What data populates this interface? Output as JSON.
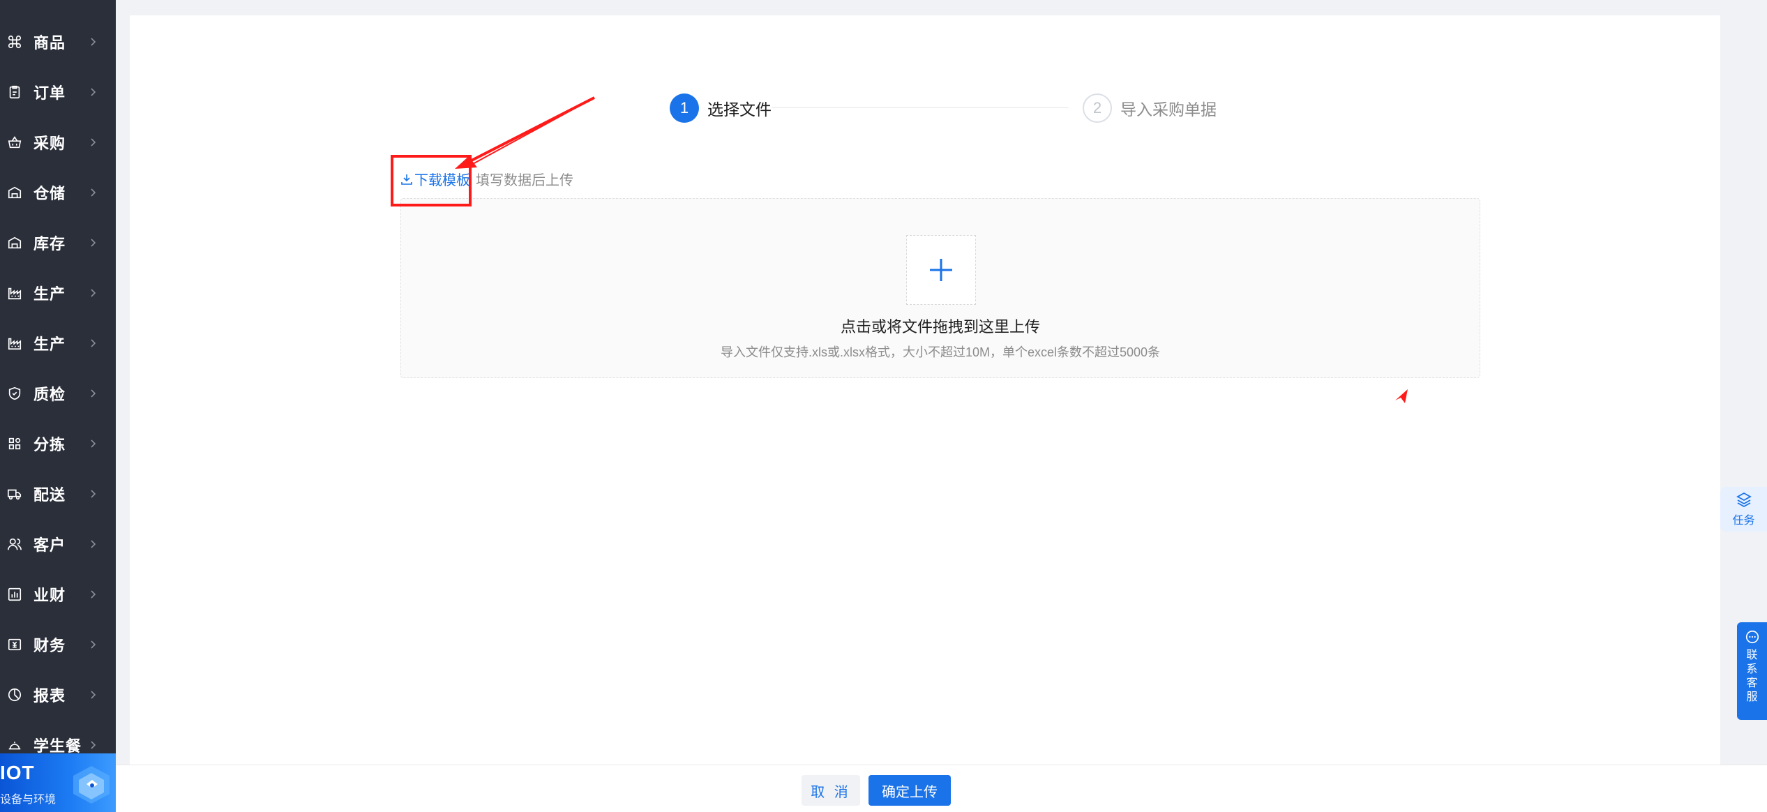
{
  "sidebar": {
    "items": [
      {
        "label": "商品",
        "icon": "command-icon"
      },
      {
        "label": "订单",
        "icon": "clipboard-icon"
      },
      {
        "label": "采购",
        "icon": "basket-icon"
      },
      {
        "label": "仓储",
        "icon": "warehouse-icon"
      },
      {
        "label": "库存",
        "icon": "warehouse-icon"
      },
      {
        "label": "生产",
        "icon": "factory-icon"
      },
      {
        "label": "生产",
        "icon": "factory-icon"
      },
      {
        "label": "质检",
        "icon": "shield-icon"
      },
      {
        "label": "分拣",
        "icon": "sort-icon"
      },
      {
        "label": "配送",
        "icon": "truck-icon"
      },
      {
        "label": "客户",
        "icon": "users-icon"
      },
      {
        "label": "业财",
        "icon": "bar-chart-icon"
      },
      {
        "label": "财务",
        "icon": "finance-icon"
      },
      {
        "label": "报表",
        "icon": "pie-chart-icon"
      },
      {
        "label": "学生餐",
        "icon": "dish-icon"
      }
    ],
    "iot_banner": {
      "title": "IOT",
      "subtitle": "设备与环境"
    }
  },
  "steps": [
    {
      "number": "1",
      "title": "选择文件",
      "state": "active"
    },
    {
      "number": "2",
      "title": "导入采购单据",
      "state": "inactive"
    }
  ],
  "download": {
    "link_label": "下载模板",
    "hint": "填写数据后上传"
  },
  "upload": {
    "title": "点击或将文件拖拽到这里上传",
    "description": "导入文件仅支持.xls或.xlsx格式，大小不超过10M，单个excel条数不超过5000条"
  },
  "floating": {
    "task_label": "任务",
    "service_label": "联系客服"
  },
  "footer": {
    "cancel_label": "取 消",
    "confirm_label": "确定上传"
  },
  "colors": {
    "primary": "#1a73e8",
    "sidebar_bg": "#2b2f3a",
    "annotation": "#ff1a1a"
  }
}
